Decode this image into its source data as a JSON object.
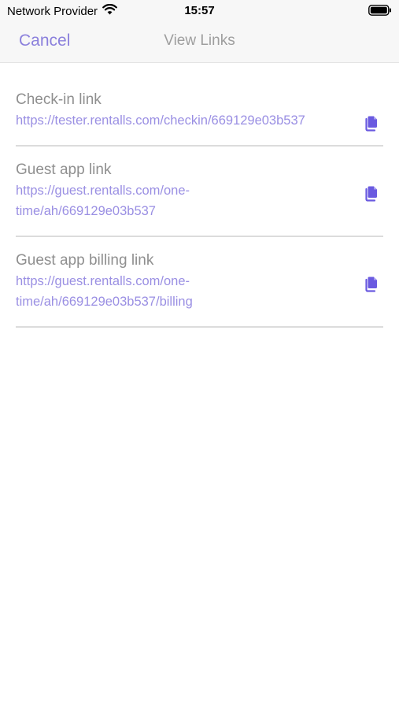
{
  "status_bar": {
    "carrier": "Network Provider",
    "time": "15:57",
    "wifi_icon": "wifi-icon",
    "battery_icon": "battery-icon"
  },
  "nav": {
    "cancel_label": "Cancel",
    "title": "View Links"
  },
  "links": [
    {
      "label": "Check-in link",
      "url_lines": [
        "https://tester.rentalls.com/checkin/669129e03b537"
      ],
      "icon": "copy-icon"
    },
    {
      "label": "Guest app link",
      "url_lines": [
        "https://guest.rentalls.com/one-",
        "time/ah/669129e03b537"
      ],
      "icon": "copy-icon"
    },
    {
      "label": "Guest app billing link",
      "url_lines": [
        "https://guest.rentalls.com/one-",
        "time/ah/669129e03b537/billing"
      ],
      "icon": "copy-icon"
    }
  ],
  "colors": {
    "accent": "#8b80dc",
    "link_text": "#9a8fe3",
    "label_text": "#8f8f8f",
    "icon": "#6a5ae0"
  }
}
